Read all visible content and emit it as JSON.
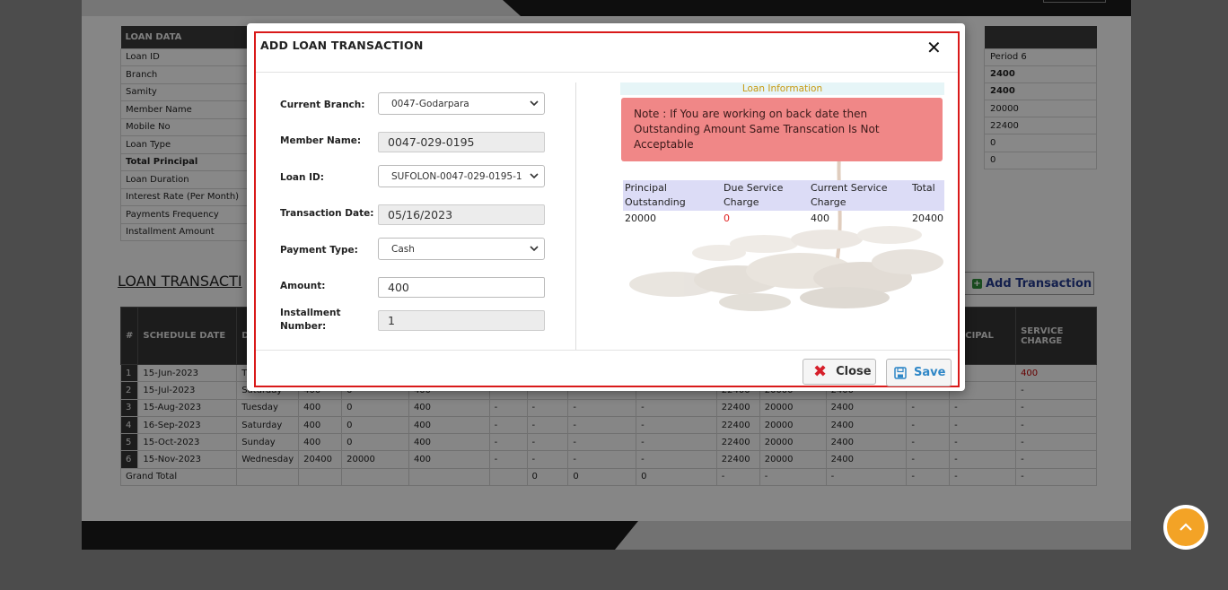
{
  "background": {
    "loan_data": {
      "header": "LOAN DATA",
      "rows": [
        "Loan ID",
        "Branch",
        "Samity",
        "Member Name",
        "Mobile No",
        "Loan Type",
        "Total Principal",
        "Loan Duration",
        "Interest Rate (Per Month)",
        "Payments Frequency",
        "Installment Amount"
      ],
      "right_values": [
        "Period 6",
        "2400",
        "2400",
        "20000",
        "22400",
        "0",
        "0"
      ]
    },
    "transactions_heading": "LOAN TRANSACTI",
    "add_transaction_label": "Add Transaction",
    "schedule": {
      "headers": [
        "#",
        "SCHEDULE DATE",
        "D",
        "",
        "",
        "",
        "",
        "",
        "",
        "",
        "",
        "",
        "",
        "INCIPAL",
        "SERVICE CHARGE"
      ],
      "rows": [
        [
          "1",
          "15-Jun-2023",
          "T",
          "",
          "",
          "",
          "",
          "",
          "",
          "",
          "",
          "",
          "",
          "",
          "400"
        ],
        [
          "2",
          "15-Jul-2023",
          "Saturday",
          "400",
          "0",
          "400",
          "",
          "",
          "",
          "",
          "22400",
          "20000",
          "2400",
          "",
          "-"
        ],
        [
          "3",
          "15-Aug-2023",
          "Tuesday",
          "400",
          "0",
          "400",
          "-",
          "-",
          "-",
          "-",
          "22400",
          "20000",
          "2400",
          "-",
          "-",
          "-"
        ],
        [
          "4",
          "16-Sep-2023",
          "Saturday",
          "400",
          "0",
          "400",
          "-",
          "-",
          "-",
          "-",
          "22400",
          "20000",
          "2400",
          "-",
          "-",
          "-"
        ],
        [
          "5",
          "15-Oct-2023",
          "Sunday",
          "400",
          "0",
          "400",
          "-",
          "-",
          "-",
          "-",
          "22400",
          "20000",
          "2400",
          "-",
          "-",
          "-"
        ],
        [
          "6",
          "15-Nov-2023",
          "Wednesday",
          "20400",
          "20000",
          "400",
          "-",
          "-",
          "-",
          "-",
          "22400",
          "20000",
          "2400",
          "-",
          "-",
          "-"
        ]
      ],
      "grand_total": [
        "Grand Total",
        "",
        "",
        "",
        "",
        "",
        "0",
        "0",
        "0",
        "-",
        "-",
        "-",
        "-",
        "-",
        "-"
      ]
    }
  },
  "modal": {
    "title": "ADD LOAN TRANSACTION",
    "fields": {
      "current_branch": {
        "label": "Current Branch:",
        "value": "0047-Godarpara"
      },
      "member_name": {
        "label": "Member Name:",
        "value": "0047-029-0195"
      },
      "loan_id": {
        "label": "Loan ID:",
        "value": "SUFOLON-0047-029-0195-1"
      },
      "transaction_date": {
        "label": "Transaction Date:",
        "value": "05/16/2023"
      },
      "payment_type": {
        "label": "Payment Type:",
        "value": "Cash"
      },
      "amount": {
        "label": "Amount:",
        "value": "400"
      },
      "installment_number": {
        "label_line1": "Installment",
        "label_line2": "Number:",
        "value": "1"
      }
    },
    "info": {
      "title": "Loan Information",
      "note": "Note : If You are working on back date then Outstanding Amount Same Transcation Is Not Acceptable",
      "table_headers": [
        "Principal Outstanding",
        "Due Service Charge",
        "Current Service Charge",
        "Total"
      ],
      "table_values": [
        "20000",
        "0",
        "400",
        "20400"
      ]
    },
    "close_label": "Close",
    "save_label": "Save"
  },
  "colors": {
    "frame_red": "#d91a1a",
    "note_bg": "#f08787",
    "info_title": "#c79a12",
    "save_blue": "#2f87c7",
    "scroll_top": "#f3a326"
  }
}
